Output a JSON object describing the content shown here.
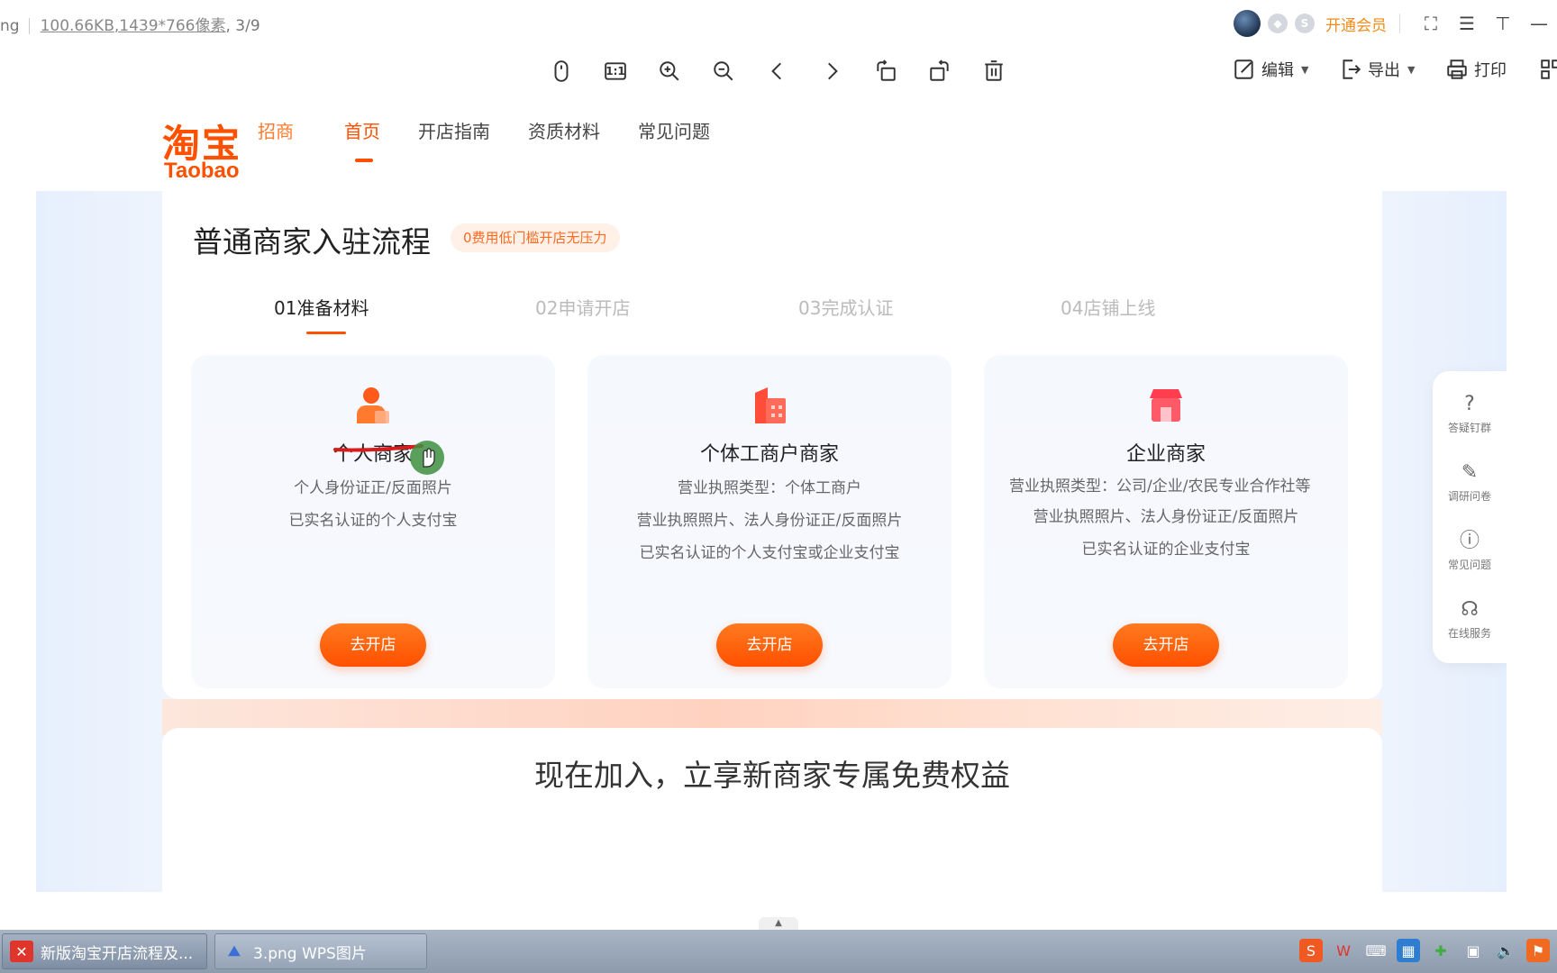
{
  "viewer": {
    "file_prefix": "ng",
    "file_size": "100.66KB",
    "dimensions": ",1439*766像素",
    "page_index": ", 3/9",
    "vip_label": "开通会员",
    "edit_label": "编辑",
    "export_label": "导出",
    "print_label": "打印",
    "actual_size_label": "1:1"
  },
  "site": {
    "logo_cn": "淘宝",
    "logo_en": "Taobao",
    "logo_sub": "招商",
    "nav": [
      "首页",
      "开店指南",
      "资质材料",
      "常见问题"
    ]
  },
  "flow": {
    "title": "普通商家入驻流程",
    "tag": "0费用低门槛开店无压力",
    "steps": [
      "01准备材料",
      "02申请开店",
      "03完成认证",
      "04店铺上线"
    ],
    "options": [
      {
        "name": "个人商家",
        "lines": [
          "个人身份证正/反面照片",
          "已实名认证的个人支付宝"
        ],
        "button": "去开店"
      },
      {
        "name": "个体工商户商家",
        "lines": [
          "营业执照类型：个体工商户",
          "营业执照照片、法人身份证正/反面照片",
          "已实名认证的个人支付宝或企业支付宝"
        ],
        "button": "去开店"
      },
      {
        "name": "企业商家",
        "lines": [
          "营业执照类型：公司/企业/农民专业合作社等",
          "营业执照照片、法人身份证正/反面照片",
          "已实名认证的企业支付宝"
        ],
        "button": "去开店"
      }
    ]
  },
  "benefits": {
    "title": "现在加入，立享新商家专属免费权益"
  },
  "side_panel": [
    {
      "icon": "question-icon",
      "label": "答疑钉群"
    },
    {
      "icon": "pen-icon",
      "label": "调研问卷"
    },
    {
      "icon": "info-icon",
      "label": "常见问题"
    },
    {
      "icon": "headset-icon",
      "label": "在线服务"
    }
  ],
  "taskbar": {
    "tasks": [
      "新版淘宝开店流程及...",
      "3.png  WPS图片"
    ]
  },
  "colors": {
    "brand": "#ff5000",
    "vip": "#f08c1a",
    "tag_bg": "#fff1e8"
  }
}
